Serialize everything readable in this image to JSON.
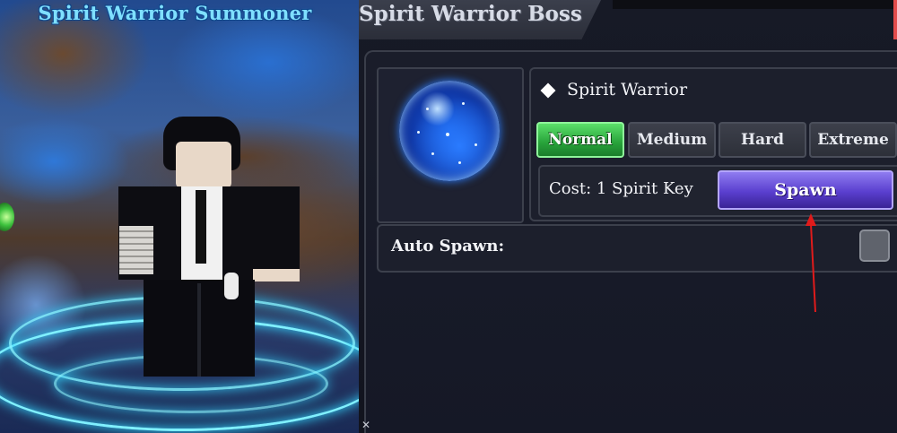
{
  "scene": {
    "title": "Spirit Warrior Summoner"
  },
  "panel": {
    "title": "Spirit Warrior Boss",
    "boss_name": "Spirit Warrior",
    "difficulties": [
      {
        "label": "Normal",
        "selected": true
      },
      {
        "label": "Medium",
        "selected": false
      },
      {
        "label": "Hard",
        "selected": false
      },
      {
        "label": "Extreme",
        "selected": false
      }
    ],
    "cost_text": "Cost: 1 Spirit Key",
    "spawn_label": "Spawn",
    "auto_spawn_label": "Auto Spawn:",
    "auto_spawn_enabled": false
  },
  "icons": {
    "boss": "diamond-icon",
    "orb": "spirit-orb-icon",
    "annotation": "red-arrow-icon",
    "corner": "resize-grip-icon"
  },
  "colors": {
    "difficulty_active": "#27a23a",
    "spawn_button": "#5a3fcf",
    "scene_title": "#7fe0ff",
    "annotation_arrow": "#e01b1b",
    "panel_bg": "#151826"
  }
}
